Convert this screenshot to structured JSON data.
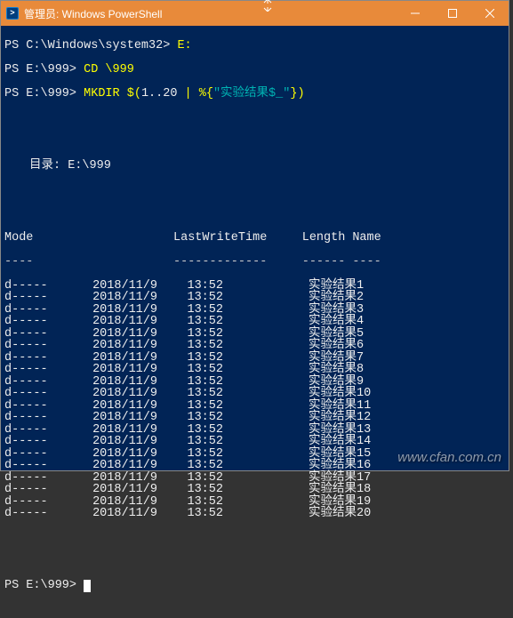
{
  "window": {
    "title": "管理员: Windows PowerShell"
  },
  "prompts": {
    "line1_prompt": "PS C:\\Windows\\system32>",
    "line1_cmd": " E:",
    "line2_prompt": "PS E:\\999>",
    "line2_cmd1": " CD ",
    "line2_cmd2": "\\999",
    "line3_prompt": "PS E:\\999>",
    "line3_cmd1": " MKDIR ",
    "line3_cmd2": "$(",
    "line3_cmd3": "1..20 ",
    "line3_cmd4": "| ",
    "line3_cmd5": "%{",
    "line3_str": "\"实验结果$_\"",
    "line3_cmd6": "})",
    "final_prompt": "PS E:\\999> "
  },
  "directory": {
    "header": "目录: E:\\999"
  },
  "columns": {
    "mode": "Mode",
    "lastwrite": "LastWriteTime",
    "length": "Length",
    "name": "Name",
    "sep_mode": "----",
    "sep_lastwrite": "-------------",
    "sep_length": "------",
    "sep_name": "----"
  },
  "rows": [
    {
      "mode": "d-----",
      "date": "2018/11/9",
      "time": "13:52",
      "length": "",
      "name": "实验结果1"
    },
    {
      "mode": "d-----",
      "date": "2018/11/9",
      "time": "13:52",
      "length": "",
      "name": "实验结果2"
    },
    {
      "mode": "d-----",
      "date": "2018/11/9",
      "time": "13:52",
      "length": "",
      "name": "实验结果3"
    },
    {
      "mode": "d-----",
      "date": "2018/11/9",
      "time": "13:52",
      "length": "",
      "name": "实验结果4"
    },
    {
      "mode": "d-----",
      "date": "2018/11/9",
      "time": "13:52",
      "length": "",
      "name": "实验结果5"
    },
    {
      "mode": "d-----",
      "date": "2018/11/9",
      "time": "13:52",
      "length": "",
      "name": "实验结果6"
    },
    {
      "mode": "d-----",
      "date": "2018/11/9",
      "time": "13:52",
      "length": "",
      "name": "实验结果7"
    },
    {
      "mode": "d-----",
      "date": "2018/11/9",
      "time": "13:52",
      "length": "",
      "name": "实验结果8"
    },
    {
      "mode": "d-----",
      "date": "2018/11/9",
      "time": "13:52",
      "length": "",
      "name": "实验结果9"
    },
    {
      "mode": "d-----",
      "date": "2018/11/9",
      "time": "13:52",
      "length": "",
      "name": "实验结果10"
    },
    {
      "mode": "d-----",
      "date": "2018/11/9",
      "time": "13:52",
      "length": "",
      "name": "实验结果11"
    },
    {
      "mode": "d-----",
      "date": "2018/11/9",
      "time": "13:52",
      "length": "",
      "name": "实验结果12"
    },
    {
      "mode": "d-----",
      "date": "2018/11/9",
      "time": "13:52",
      "length": "",
      "name": "实验结果13"
    },
    {
      "mode": "d-----",
      "date": "2018/11/9",
      "time": "13:52",
      "length": "",
      "name": "实验结果14"
    },
    {
      "mode": "d-----",
      "date": "2018/11/9",
      "time": "13:52",
      "length": "",
      "name": "实验结果15"
    },
    {
      "mode": "d-----",
      "date": "2018/11/9",
      "time": "13:52",
      "length": "",
      "name": "实验结果16"
    },
    {
      "mode": "d-----",
      "date": "2018/11/9",
      "time": "13:52",
      "length": "",
      "name": "实验结果17"
    },
    {
      "mode": "d-----",
      "date": "2018/11/9",
      "time": "13:52",
      "length": "",
      "name": "实验结果18"
    },
    {
      "mode": "d-----",
      "date": "2018/11/9",
      "time": "13:52",
      "length": "",
      "name": "实验结果19"
    },
    {
      "mode": "d-----",
      "date": "2018/11/9",
      "time": "13:52",
      "length": "",
      "name": "实验结果20"
    }
  ],
  "watermark": "www.cfan.com.cn"
}
